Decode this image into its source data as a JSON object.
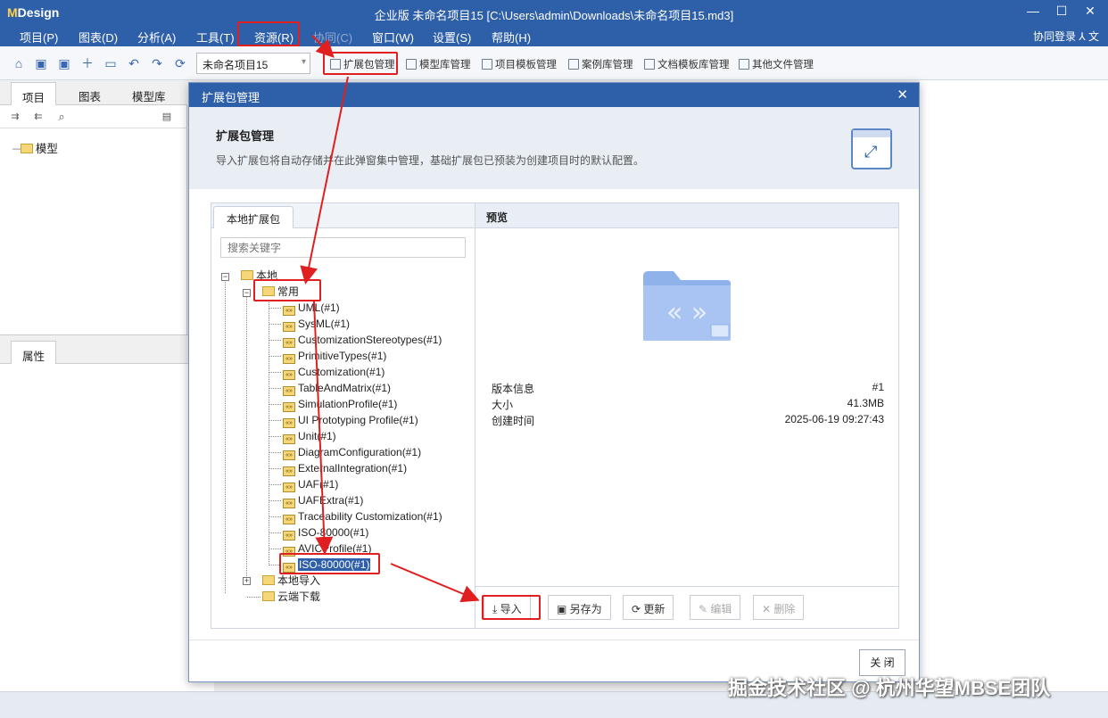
{
  "app": {
    "logo_prefix": "M",
    "logo_text": "Design",
    "window_title": "企业版   未命名项目15 [C:\\Users\\admin\\Downloads\\未命名项目15.md3]",
    "login": "协同登录 ⅄ 文"
  },
  "menu": {
    "items": [
      "项目(P)",
      "图表(D)",
      "分析(A)",
      "工具(T)",
      "资源(R)",
      "协同(C)",
      "窗口(W)",
      "设置(S)",
      "帮助(H)"
    ]
  },
  "toolbar": {
    "project_select": "未命名项目15",
    "buttons": [
      "扩展包管理",
      "模型库管理",
      "项目模板管理",
      "案例库管理",
      "文档模板库管理",
      "其他文件管理"
    ]
  },
  "left_panel": {
    "tabs": [
      "项目",
      "图表",
      "模型库"
    ],
    "tree_root": "模型",
    "properties_tab": "属性"
  },
  "dialog": {
    "title": "扩展包管理",
    "heading": "扩展包管理",
    "description": "导入扩展包将自动存储并在此弹窗集中管理，基础扩展包已预装为创建项目时的默认配置。",
    "local_tab": "本地扩展包",
    "search_placeholder": "搜索关键字",
    "tree": {
      "root": "本地",
      "common": "常用",
      "packages": [
        "UML(#1)",
        "SysML(#1)",
        "CustomizationStereotypes(#1)",
        "PrimitiveTypes(#1)",
        "Customization(#1)",
        "TableAndMatrix(#1)",
        "SimulationProfile(#1)",
        "UI Prototyping Profile(#1)",
        "Unit(#1)",
        "DiagramConfiguration(#1)",
        "ExternalIntegration(#1)",
        "UAF(#1)",
        "UAFExtra(#1)",
        "Traceability Customization(#1)",
        "ISO-80000(#1)",
        "AVICProfile(#1)",
        "ISO-80000(#1)"
      ],
      "local_import": "本地导入",
      "cloud_download": "云端下载"
    },
    "preview": {
      "title": "预览",
      "version_label": "版本信息",
      "version_value": "#1",
      "size_label": "大小",
      "size_value": "41.3MB",
      "created_label": "创建时间",
      "created_value": "2025-06-19 09:27:43"
    },
    "actions": {
      "import": "导入",
      "save_as": "另存为",
      "update": "更新",
      "edit": "编辑",
      "delete": "删除"
    },
    "close": "关 闭"
  },
  "watermark": "掘金技术社区 @ 杭州华望MBSE团队",
  "colors": {
    "brand": "#2e5fa9",
    "highlight": "#e02020"
  }
}
